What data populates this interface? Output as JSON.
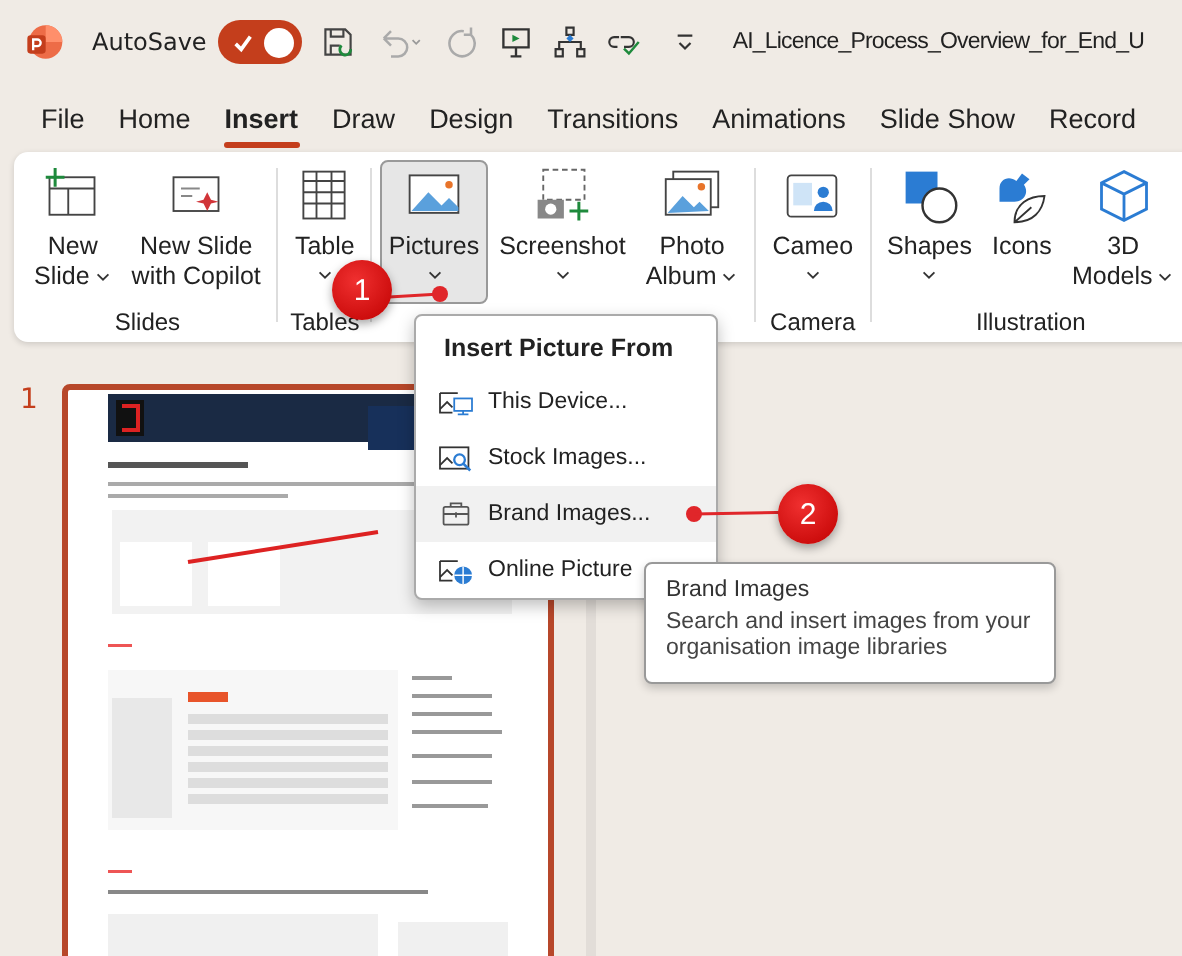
{
  "title_bar": {
    "autosave_label": "AutoSave",
    "autosave_on": true,
    "filename": "AI_Licence_Process_Overview_for_End_U"
  },
  "tabs": [
    {
      "label": "File",
      "selected": false
    },
    {
      "label": "Home",
      "selected": false
    },
    {
      "label": "Insert",
      "selected": true
    },
    {
      "label": "Draw",
      "selected": false
    },
    {
      "label": "Design",
      "selected": false
    },
    {
      "label": "Transitions",
      "selected": false
    },
    {
      "label": "Animations",
      "selected": false
    },
    {
      "label": "Slide Show",
      "selected": false
    },
    {
      "label": "Record",
      "selected": false
    }
  ],
  "ribbon_groups": [
    {
      "label": "Slides",
      "commands": [
        {
          "kind": "newslide",
          "lines": [
            "New",
            "Slide"
          ],
          "dropdown": true,
          "selected": false
        },
        {
          "kind": "copilot",
          "lines": [
            "New Slide",
            "with Copilot"
          ],
          "dropdown": false,
          "selected": false
        }
      ]
    },
    {
      "label": "Tables",
      "commands": [
        {
          "kind": "table",
          "lines": [
            "Table"
          ],
          "dropdown": true,
          "selected": false
        }
      ]
    },
    {
      "commands": [
        {
          "kind": "picture",
          "lines": [
            "Pictures"
          ],
          "dropdown": true,
          "selected": true
        },
        {
          "kind": "screenshot",
          "lines": [
            "Screenshot"
          ],
          "dropdown": true,
          "selected": false
        },
        {
          "kind": "album",
          "lines": [
            "Photo",
            "Album"
          ],
          "dropdown": true,
          "selected": false
        }
      ]
    },
    {
      "label": "Camera",
      "commands": [
        {
          "kind": "cameo",
          "lines": [
            "Cameo"
          ],
          "dropdown": true,
          "selected": false
        }
      ]
    },
    {
      "label": "Illustration",
      "commands": [
        {
          "kind": "shapes",
          "lines": [
            "Shapes"
          ],
          "dropdown": true,
          "selected": false
        },
        {
          "kind": "icons",
          "lines": [
            "Icons"
          ],
          "dropdown": false,
          "selected": false
        },
        {
          "kind": "cube",
          "lines": [
            "3D",
            "Models"
          ],
          "dropdown": true,
          "selected": false
        }
      ]
    }
  ],
  "picture_menu": {
    "heading": "Insert Picture From",
    "items": [
      {
        "kind": "device",
        "label": "This Device...",
        "hovered": false
      },
      {
        "kind": "stock",
        "label": "Stock Images...",
        "hovered": false
      },
      {
        "kind": "brand",
        "label": "Brand Images...",
        "hovered": true
      },
      {
        "kind": "online",
        "label": "Online Picture",
        "hovered": false
      }
    ]
  },
  "tooltip": {
    "title": "Brand Images",
    "body": "Search and insert images from your organisation image libraries"
  },
  "step_markers": [
    "1",
    "2"
  ],
  "slides": [
    {
      "number": "1",
      "selected": true
    }
  ]
}
